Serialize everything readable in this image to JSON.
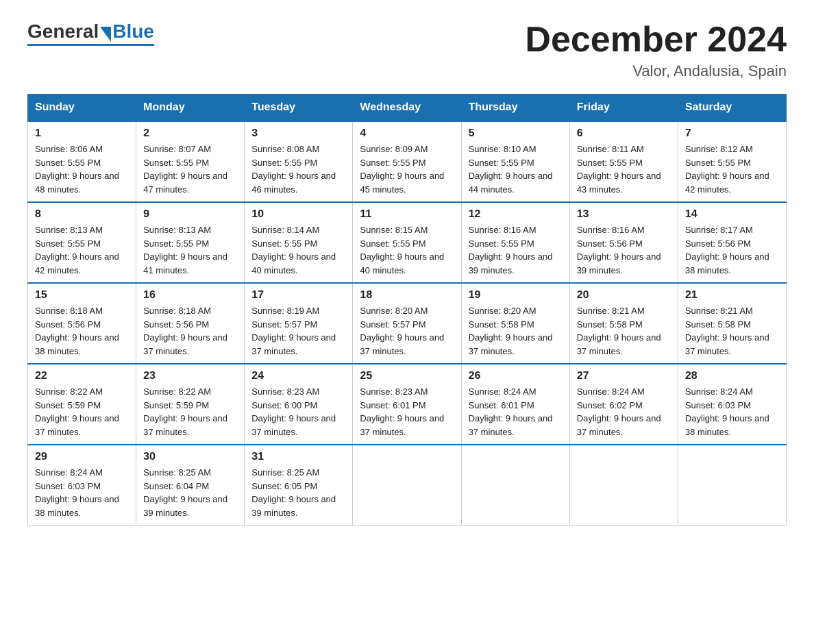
{
  "logo": {
    "general": "General",
    "blue": "Blue"
  },
  "title": {
    "month": "December 2024",
    "location": "Valor, Andalusia, Spain"
  },
  "weekdays": [
    "Sunday",
    "Monday",
    "Tuesday",
    "Wednesday",
    "Thursday",
    "Friday",
    "Saturday"
  ],
  "weeks": [
    [
      {
        "day": "1",
        "sunrise": "8:06 AM",
        "sunset": "5:55 PM",
        "daylight": "9 hours and 48 minutes."
      },
      {
        "day": "2",
        "sunrise": "8:07 AM",
        "sunset": "5:55 PM",
        "daylight": "9 hours and 47 minutes."
      },
      {
        "day": "3",
        "sunrise": "8:08 AM",
        "sunset": "5:55 PM",
        "daylight": "9 hours and 46 minutes."
      },
      {
        "day": "4",
        "sunrise": "8:09 AM",
        "sunset": "5:55 PM",
        "daylight": "9 hours and 45 minutes."
      },
      {
        "day": "5",
        "sunrise": "8:10 AM",
        "sunset": "5:55 PM",
        "daylight": "9 hours and 44 minutes."
      },
      {
        "day": "6",
        "sunrise": "8:11 AM",
        "sunset": "5:55 PM",
        "daylight": "9 hours and 43 minutes."
      },
      {
        "day": "7",
        "sunrise": "8:12 AM",
        "sunset": "5:55 PM",
        "daylight": "9 hours and 42 minutes."
      }
    ],
    [
      {
        "day": "8",
        "sunrise": "8:13 AM",
        "sunset": "5:55 PM",
        "daylight": "9 hours and 42 minutes."
      },
      {
        "day": "9",
        "sunrise": "8:13 AM",
        "sunset": "5:55 PM",
        "daylight": "9 hours and 41 minutes."
      },
      {
        "day": "10",
        "sunrise": "8:14 AM",
        "sunset": "5:55 PM",
        "daylight": "9 hours and 40 minutes."
      },
      {
        "day": "11",
        "sunrise": "8:15 AM",
        "sunset": "5:55 PM",
        "daylight": "9 hours and 40 minutes."
      },
      {
        "day": "12",
        "sunrise": "8:16 AM",
        "sunset": "5:55 PM",
        "daylight": "9 hours and 39 minutes."
      },
      {
        "day": "13",
        "sunrise": "8:16 AM",
        "sunset": "5:56 PM",
        "daylight": "9 hours and 39 minutes."
      },
      {
        "day": "14",
        "sunrise": "8:17 AM",
        "sunset": "5:56 PM",
        "daylight": "9 hours and 38 minutes."
      }
    ],
    [
      {
        "day": "15",
        "sunrise": "8:18 AM",
        "sunset": "5:56 PM",
        "daylight": "9 hours and 38 minutes."
      },
      {
        "day": "16",
        "sunrise": "8:18 AM",
        "sunset": "5:56 PM",
        "daylight": "9 hours and 37 minutes."
      },
      {
        "day": "17",
        "sunrise": "8:19 AM",
        "sunset": "5:57 PM",
        "daylight": "9 hours and 37 minutes."
      },
      {
        "day": "18",
        "sunrise": "8:20 AM",
        "sunset": "5:57 PM",
        "daylight": "9 hours and 37 minutes."
      },
      {
        "day": "19",
        "sunrise": "8:20 AM",
        "sunset": "5:58 PM",
        "daylight": "9 hours and 37 minutes."
      },
      {
        "day": "20",
        "sunrise": "8:21 AM",
        "sunset": "5:58 PM",
        "daylight": "9 hours and 37 minutes."
      },
      {
        "day": "21",
        "sunrise": "8:21 AM",
        "sunset": "5:58 PM",
        "daylight": "9 hours and 37 minutes."
      }
    ],
    [
      {
        "day": "22",
        "sunrise": "8:22 AM",
        "sunset": "5:59 PM",
        "daylight": "9 hours and 37 minutes."
      },
      {
        "day": "23",
        "sunrise": "8:22 AM",
        "sunset": "5:59 PM",
        "daylight": "9 hours and 37 minutes."
      },
      {
        "day": "24",
        "sunrise": "8:23 AM",
        "sunset": "6:00 PM",
        "daylight": "9 hours and 37 minutes."
      },
      {
        "day": "25",
        "sunrise": "8:23 AM",
        "sunset": "6:01 PM",
        "daylight": "9 hours and 37 minutes."
      },
      {
        "day": "26",
        "sunrise": "8:24 AM",
        "sunset": "6:01 PM",
        "daylight": "9 hours and 37 minutes."
      },
      {
        "day": "27",
        "sunrise": "8:24 AM",
        "sunset": "6:02 PM",
        "daylight": "9 hours and 37 minutes."
      },
      {
        "day": "28",
        "sunrise": "8:24 AM",
        "sunset": "6:03 PM",
        "daylight": "9 hours and 38 minutes."
      }
    ],
    [
      {
        "day": "29",
        "sunrise": "8:24 AM",
        "sunset": "6:03 PM",
        "daylight": "9 hours and 38 minutes."
      },
      {
        "day": "30",
        "sunrise": "8:25 AM",
        "sunset": "6:04 PM",
        "daylight": "9 hours and 39 minutes."
      },
      {
        "day": "31",
        "sunrise": "8:25 AM",
        "sunset": "6:05 PM",
        "daylight": "9 hours and 39 minutes."
      },
      null,
      null,
      null,
      null
    ]
  ],
  "colors": {
    "header_bg": "#1a6faf",
    "header_text": "#ffffff",
    "border": "#1a6faf"
  }
}
